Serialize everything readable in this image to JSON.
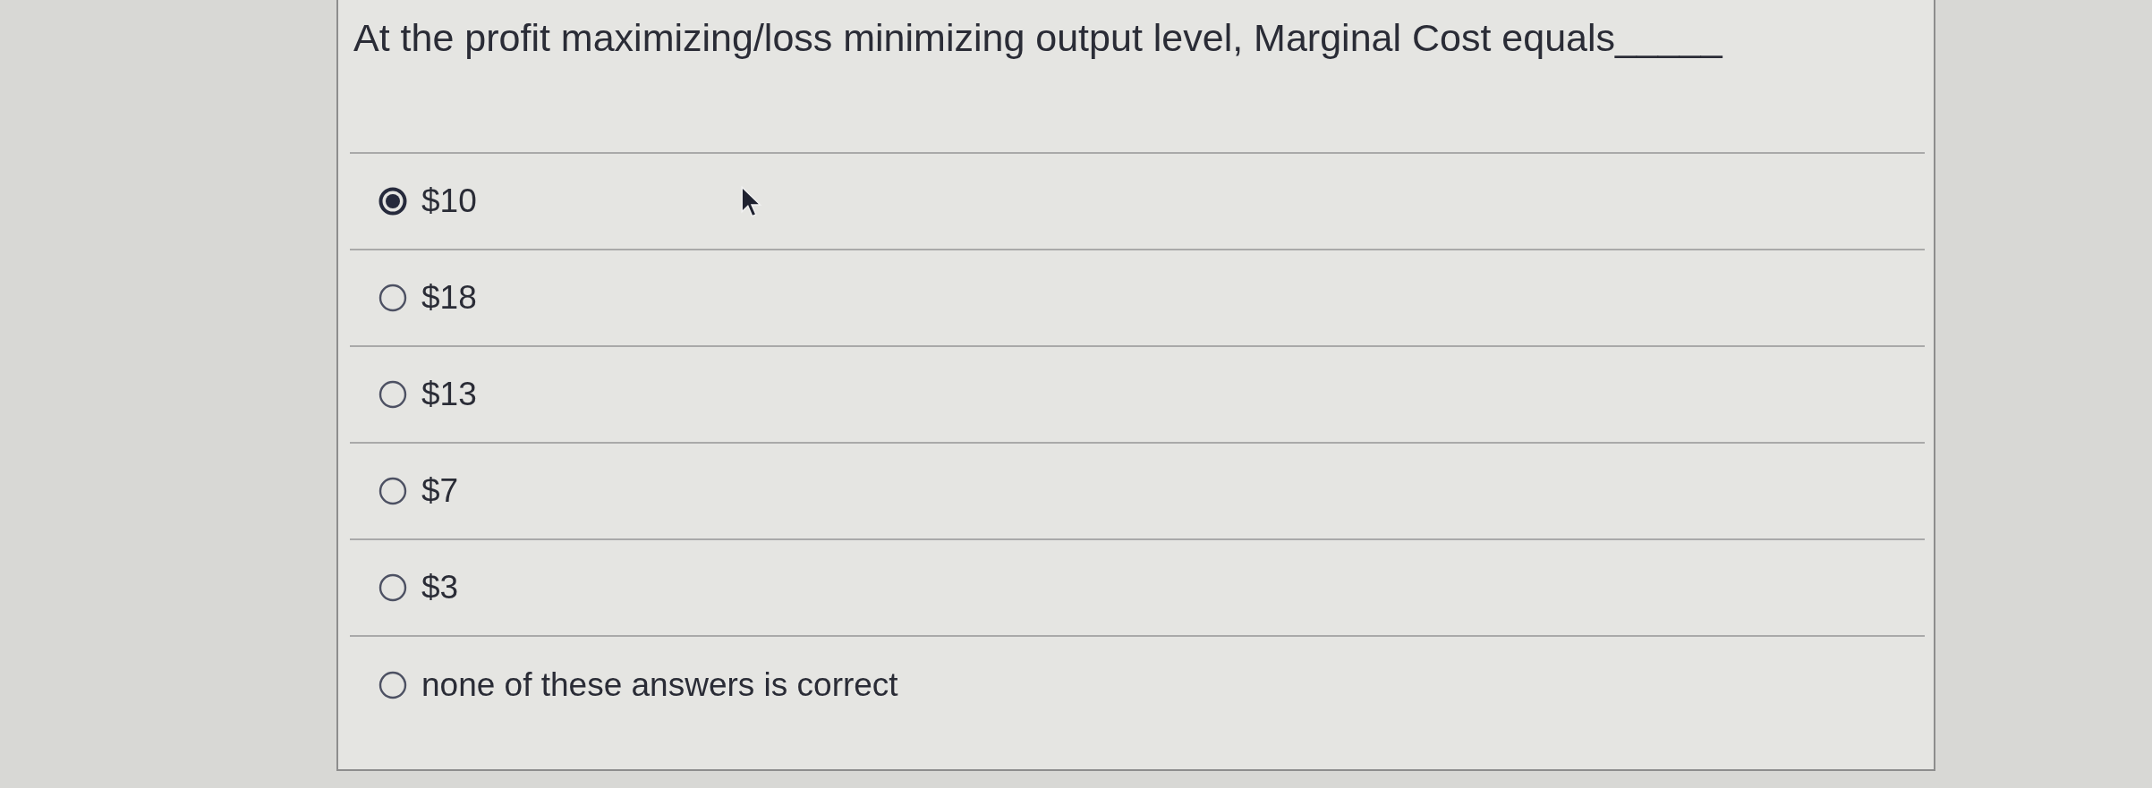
{
  "question": {
    "text": "At the profit maximizing/loss minimizing output level, Marginal Cost equals_____"
  },
  "options": [
    {
      "label": "$10",
      "selected": true
    },
    {
      "label": "$18",
      "selected": false
    },
    {
      "label": "$13",
      "selected": false
    },
    {
      "label": "$7",
      "selected": false
    },
    {
      "label": "$3",
      "selected": false
    },
    {
      "label": "none of these answers is correct",
      "selected": false
    }
  ]
}
